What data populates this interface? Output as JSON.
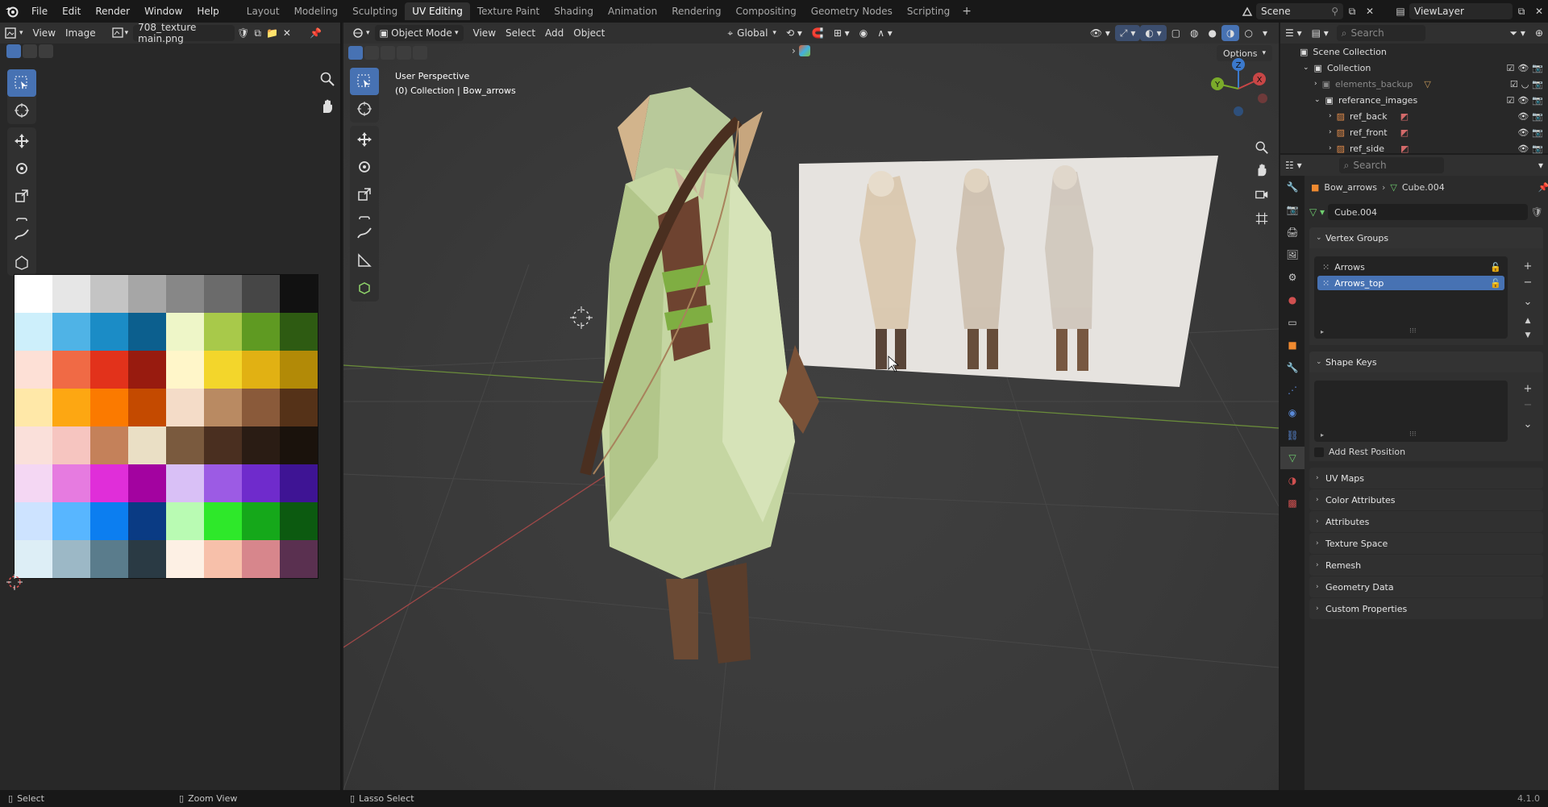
{
  "menubar": {
    "items": [
      "File",
      "Edit",
      "Render",
      "Window",
      "Help"
    ],
    "workspaces": [
      "Layout",
      "Modeling",
      "Sculpting",
      "UV Editing",
      "Texture Paint",
      "Shading",
      "Animation",
      "Rendering",
      "Compositing",
      "Geometry Nodes",
      "Scripting"
    ],
    "active_workspace": "UV Editing",
    "scene": "Scene",
    "view_layer": "ViewLayer"
  },
  "image_editor": {
    "menu_view": "View",
    "menu_image": "Image",
    "image_name": "708_texture main.png",
    "palette_colors": [
      "#ffffff",
      "#e6e6e6",
      "#c4c4c4",
      "#a6a6a6",
      "#878787",
      "#6b6b6b",
      "#464646",
      "#111111",
      "#cdeffb",
      "#4fb3e6",
      "#1b8cc6",
      "#0c5f8e",
      "#eef6c8",
      "#a8c94a",
      "#5f9a22",
      "#2e5b12",
      "#fde0d6",
      "#f06a45",
      "#e2321b",
      "#981b0f",
      "#fff6c9",
      "#f3d62b",
      "#e1b113",
      "#b28a07",
      "#ffe8a8",
      "#fda712",
      "#fb7a00",
      "#c44a00",
      "#f4dcc8",
      "#b98a62",
      "#8a5a3a",
      "#553218",
      "#fae0da",
      "#f6c5c0",
      "#c4815a",
      "#eadfc5",
      "#7a5a3e",
      "#4a2f20",
      "#2a1c14",
      "#1a120c",
      "#f4d7f3",
      "#e67be0",
      "#e02ed9",
      "#a303a0",
      "#d9c0f6",
      "#9c5be4",
      "#6f2bcc",
      "#3e1494",
      "#cde3ff",
      "#58b6ff",
      "#0c7ef0",
      "#0a3b84",
      "#b9fbb3",
      "#2ee82a",
      "#15a81a",
      "#0c5a10",
      "#ddeef6",
      "#9cb8c6",
      "#5a7c8c",
      "#2a3a44",
      "#fdf0e4",
      "#f7c0aa",
      "#d7868c",
      "#5a3050"
    ]
  },
  "viewport": {
    "mode": "Object Mode",
    "menus": [
      "View",
      "Select",
      "Add",
      "Object"
    ],
    "transform_orientation": "Global",
    "info_line1": "User Perspective",
    "info_line2": "(0) Collection | Bow_arrows",
    "options_label": "Options",
    "axes": {
      "x": "X",
      "y": "Y",
      "z": "Z"
    }
  },
  "outliner": {
    "search_placeholder": "Search",
    "root": "Scene Collection",
    "rows": [
      {
        "label": "Collection"
      },
      {
        "label": "elements_backup"
      },
      {
        "label": "referance_images"
      },
      {
        "label": "ref_back"
      },
      {
        "label": "ref_front"
      },
      {
        "label": "ref_side"
      }
    ]
  },
  "properties": {
    "search_placeholder": "Search",
    "breadcrumb_object": "Bow_arrows",
    "breadcrumb_data": "Cube.004",
    "data_name": "Cube.004",
    "vertex_groups_title": "Vertex Groups",
    "vertex_groups": [
      "Arrows",
      "Arrows_top"
    ],
    "selected_vertex_group": "Arrows_top",
    "shape_keys_title": "Shape Keys",
    "add_rest_position": "Add Rest Position",
    "collapsed_panels": [
      "UV Maps",
      "Color Attributes",
      "Attributes",
      "Texture Space",
      "Remesh",
      "Geometry Data",
      "Custom Properties"
    ]
  },
  "statusbar": {
    "left_action": "Select",
    "middle_action": "Zoom View",
    "right_action": "Lasso Select",
    "version": "4.1.0"
  }
}
